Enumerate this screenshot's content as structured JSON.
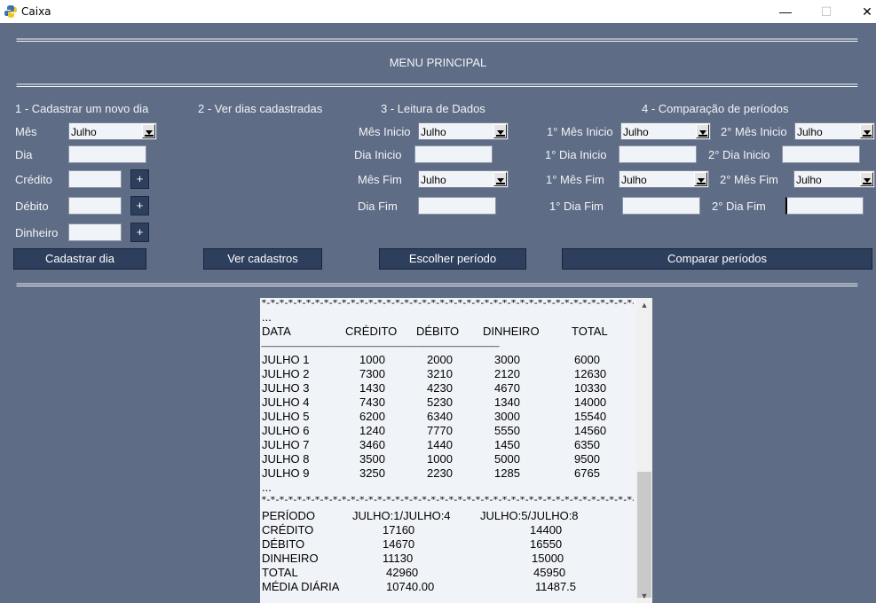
{
  "window": {
    "title": "Caixa",
    "minimize": "—",
    "maximize": "☐",
    "close": "✕"
  },
  "separator": "=============================================================================================================================================================================",
  "menu_title": "MENU PRINCIPAL",
  "sections": {
    "s1": "1 - Cadastrar um novo dia",
    "s2": "2 - Ver dias cadastradas",
    "s3": "3 - Leitura de Dados",
    "s4": "4 - Comparação de períodos"
  },
  "form1": {
    "mes_label": "Mês",
    "mes_value": "Julho",
    "dia_label": "Dia",
    "credito_label": "Crédito",
    "debito_label": "Débito",
    "dinheiro_label": "Dinheiro",
    "plus": "+",
    "button": "Cadastrar dia"
  },
  "form2": {
    "button": "Ver cadastros"
  },
  "form3": {
    "mes_inicio_label": "Mês Inicio",
    "mes_inicio_value": "Julho",
    "dia_inicio_label": "Dia Inicio",
    "mes_fim_label": "Mês Fim",
    "mes_fim_value": "Julho",
    "dia_fim_label": "Dia Fim",
    "button": "Escolher período"
  },
  "form4": {
    "m1_inicio_label": "1° Mês Inicio",
    "m1_inicio_value": "Julho",
    "d1_inicio_label": "1° Dia Inicio",
    "m1_fim_label": "1° Mês Fim",
    "m1_fim_value": "Julho",
    "d1_fim_label": "1° Dia Fim",
    "m2_inicio_label": "2° Mês Inicio",
    "m2_inicio_value": "Julho",
    "d2_inicio_label": "2° Dia Inicio",
    "m2_fim_label": "2° Mês Fim",
    "m2_fim_value": "Julho",
    "d2_fim_label": "2° Dia Fim",
    "button": "Comparar períodos"
  },
  "output": {
    "stars": "*-*-*-*-*-*-*-*-*-*-*-*-*-*-*-*-*-*-*-*-*-*-*-*-*-*-*-*-*-*-*-*-*-*-*-*-*-*-*-*-*-*-*-*-*-*-*-*-*-*-*-*-*-*-*-*-*-*-*-*-*-*-*-*-*-*-*-*",
    "dashes": "----------------------------------------------------------------------------------------------------------------------------------",
    "ellipsis": "...",
    "headers": [
      "DATA",
      "CRÉDITO",
      "DÉBITO",
      "DINHEIRO",
      "TOTAL"
    ],
    "rows": [
      [
        "JULHO 1",
        "1000",
        "2000",
        "3000",
        "6000"
      ],
      [
        "JULHO 2",
        "7300",
        "3210",
        "2120",
        "12630"
      ],
      [
        "JULHO 3",
        "1430",
        "4230",
        "4670",
        "10330"
      ],
      [
        "JULHO 4",
        "7430",
        "5230",
        "1340",
        "14000"
      ],
      [
        "JULHO 5",
        "6200",
        "6340",
        "3000",
        "15540"
      ],
      [
        "JULHO 6",
        "1240",
        "7770",
        "5550",
        "14560"
      ],
      [
        "JULHO 7",
        "3460",
        "1440",
        "1450",
        "6350"
      ],
      [
        "JULHO 8",
        "3500",
        "1000",
        "5000",
        "9500"
      ],
      [
        "JULHO 9",
        "3250",
        "2230",
        "1285",
        "6765"
      ]
    ],
    "comparison": [
      [
        "PERÍODO",
        "JULHO:1/JULHO:4",
        "JULHO:5/JULHO:8"
      ],
      [
        "CRÉDITO",
        "17160",
        "14400"
      ],
      [
        "DÉBITO",
        "14670",
        "16550"
      ],
      [
        "DINHEIRO",
        "11130",
        "15000"
      ],
      [
        "TOTAL",
        "42960",
        "45950"
      ],
      [
        "MÉDIA DIÁRIA",
        "10740.00",
        "11487.5"
      ]
    ]
  }
}
